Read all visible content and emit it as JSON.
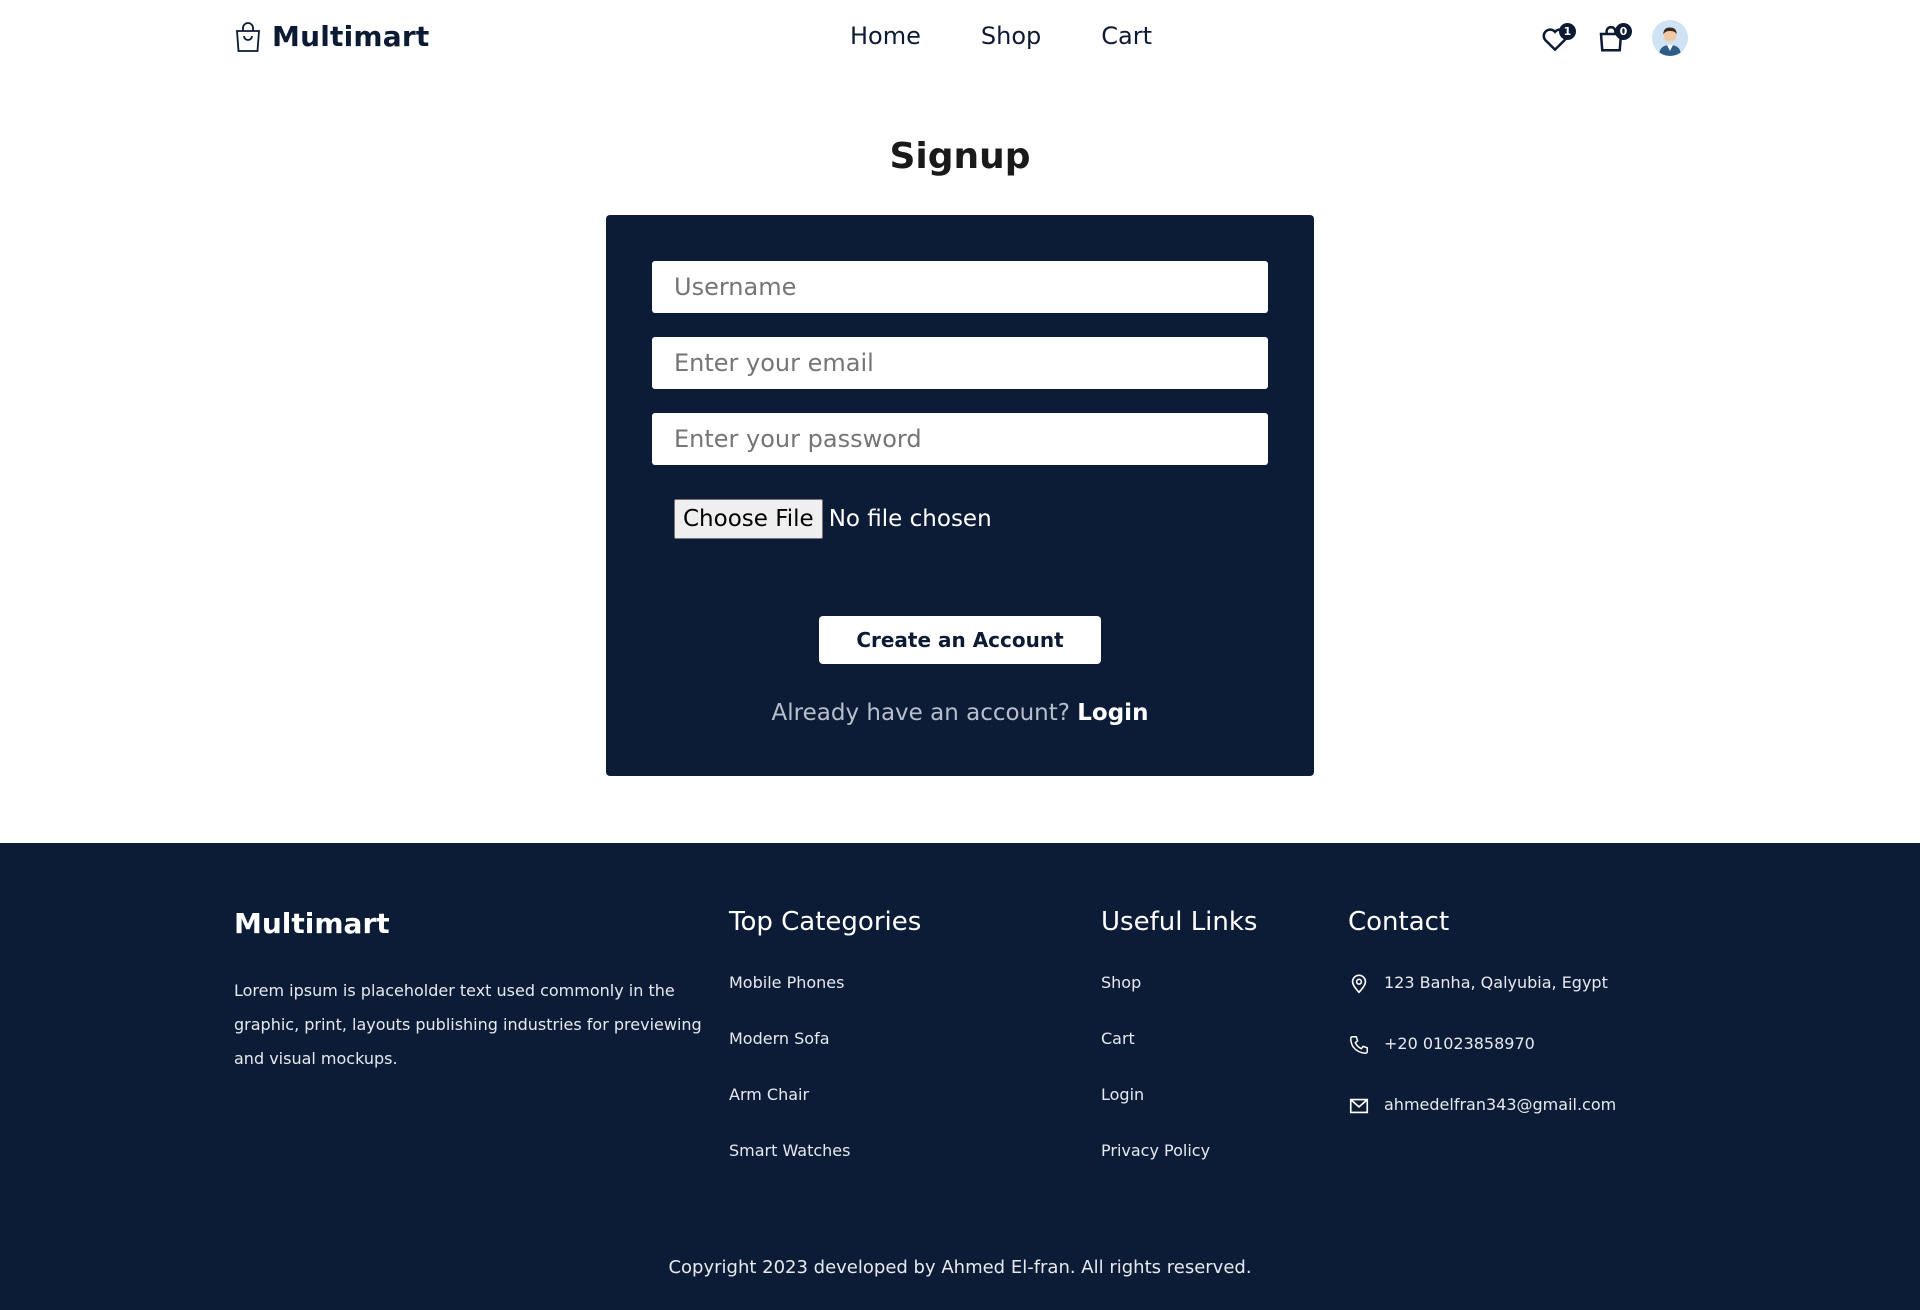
{
  "header": {
    "brand": "Multimart",
    "nav": [
      "Home",
      "Shop",
      "Cart"
    ],
    "wishlist_count": "1",
    "cart_count": "0"
  },
  "page": {
    "title": "Signup"
  },
  "form": {
    "username_placeholder": "Username",
    "email_placeholder": "Enter your email",
    "password_placeholder": "Enter your password",
    "file_button": "Choose File",
    "file_status": "No file chosen",
    "submit_label": "Create an Account",
    "login_prompt": "Already have an account?",
    "login_link": "Login"
  },
  "footer": {
    "brand": "Multimart",
    "description": "Lorem ipsum is placeholder text used commonly in the graphic, print, layouts publishing industries for previewing and visual mockups.",
    "categories_title": "Top Categories",
    "categories": [
      "Mobile Phones",
      "Modern Sofa",
      "Arm Chair",
      "Smart Watches"
    ],
    "links_title": "Useful Links",
    "links": [
      "Shop",
      "Cart",
      "Login",
      "Privacy Policy"
    ],
    "contact_title": "Contact",
    "contact": {
      "address": "123 Banha, Qalyubia, Egypt",
      "phone": "+20 01023858970",
      "email": "ahmedelfran343@gmail.com"
    },
    "copyright": "Copyright 2023 developed by Ahmed El-fran. All rights reserved."
  },
  "colors": {
    "navy": "#0d1c36",
    "white": "#ffffff"
  }
}
